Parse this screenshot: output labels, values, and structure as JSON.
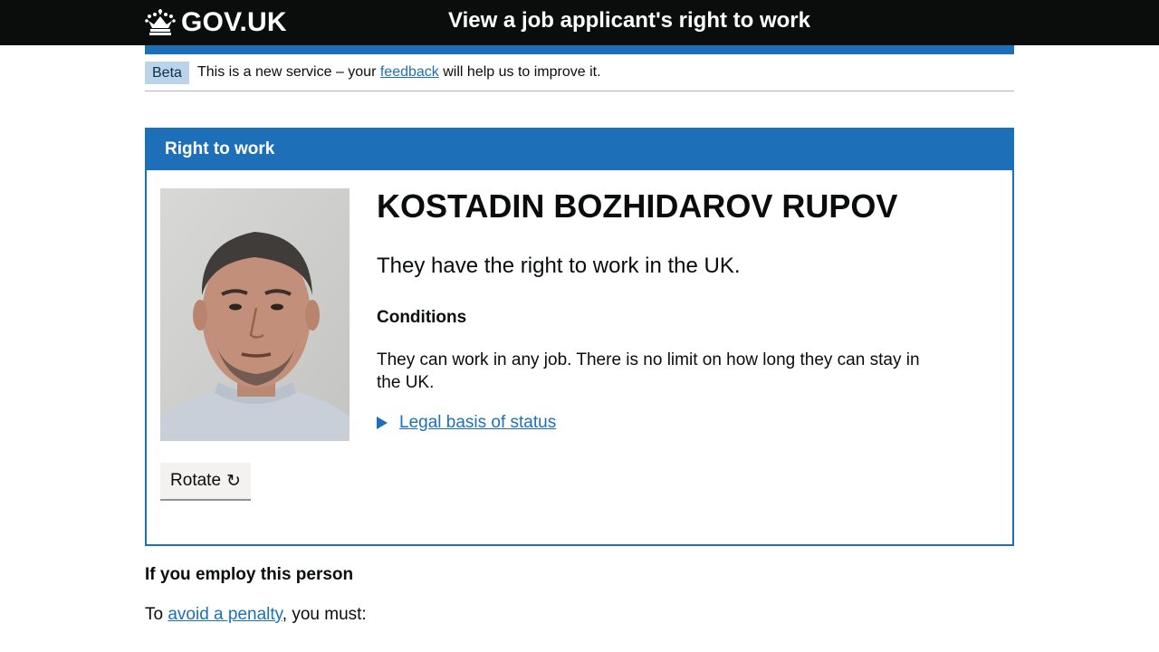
{
  "header": {
    "logo_text": "GOV.UK",
    "service_name": "View a job applicant's right to work"
  },
  "phase_banner": {
    "tag": "Beta",
    "text_before": "This is a new service – your",
    "link_text": "feedback",
    "text_after": "will help us to improve it."
  },
  "card": {
    "title": "Right to work",
    "photo_icon": "applicant-photo",
    "rotate_label": "Rotate",
    "rotate_icon": "↻",
    "name": "KOSTADIN BOZHIDAROV RUPOV",
    "status": "They have the right to work in the UK.",
    "conditions_heading": "Conditions",
    "conditions_text": "They can work in any job. There is no limit on how long they can stay in the UK.",
    "details_summary": "Legal basis of status"
  },
  "employ": {
    "heading": "If you employ this person",
    "text_before": "To",
    "link_text": "avoid a penalty",
    "text_after": ", you must:"
  },
  "colors": {
    "header_bg": "#0b0c0c",
    "brand_blue": "#1d70b8",
    "phase_tag_bg": "#bbd4ea",
    "button_bg": "#f3f2f1"
  }
}
